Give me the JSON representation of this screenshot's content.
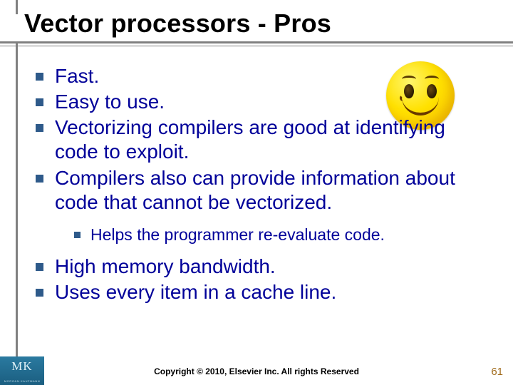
{
  "title": "Vector processors - Pros",
  "bullets": [
    "Fast.",
    "Easy to use.",
    "Vectorizing compilers are good at identifying code to exploit.",
    "Compilers also can provide information about code that cannot be vectorized."
  ],
  "sub_bullets": [
    "Helps the programmer re-evaluate code."
  ],
  "bullets2": [
    "High memory bandwidth.",
    "Uses every item in a cache line."
  ],
  "footer": "Copyright © 2010, Elsevier Inc. All rights Reserved",
  "page_number": "61",
  "logo": {
    "initials": "MK",
    "sub": "MORGAN KAUFMANN"
  }
}
